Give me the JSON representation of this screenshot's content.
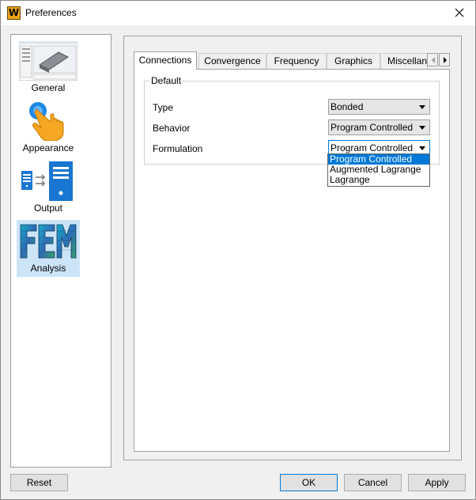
{
  "window": {
    "title": "Preferences",
    "app_icon_letter": "W"
  },
  "categories": [
    {
      "label": "General",
      "icon": "screenshot-thumbnail-icon",
      "selected": false
    },
    {
      "label": "Appearance",
      "icon": "pointing-hand-icon",
      "selected": false
    },
    {
      "label": "Output",
      "icon": "file-transfer-icon",
      "selected": false
    },
    {
      "label": "Analysis",
      "icon": "fem-mesh-icon",
      "selected": true
    }
  ],
  "tabs": [
    {
      "label": "Connections",
      "active": true
    },
    {
      "label": "Convergence",
      "active": false
    },
    {
      "label": "Frequency",
      "active": false
    },
    {
      "label": "Graphics",
      "active": false
    },
    {
      "label": "Miscellanec",
      "active": false
    }
  ],
  "group": {
    "title": "Default",
    "rows": [
      {
        "label": "Type",
        "value": "Bonded"
      },
      {
        "label": "Behavior",
        "value": "Program Controlled"
      },
      {
        "label": "Formulation",
        "value": "Program Controlled"
      }
    ]
  },
  "dropdown": {
    "options": [
      "Program Controlled",
      "Augmented Lagrange",
      "Lagrange"
    ],
    "highlighted_index": 0
  },
  "buttons": {
    "reset": "Reset",
    "ok": "OK",
    "cancel": "Cancel",
    "apply": "Apply"
  },
  "colors": {
    "accent": "#0078d7",
    "selection": "#cce4f7",
    "app_icon": "#e8a317"
  }
}
